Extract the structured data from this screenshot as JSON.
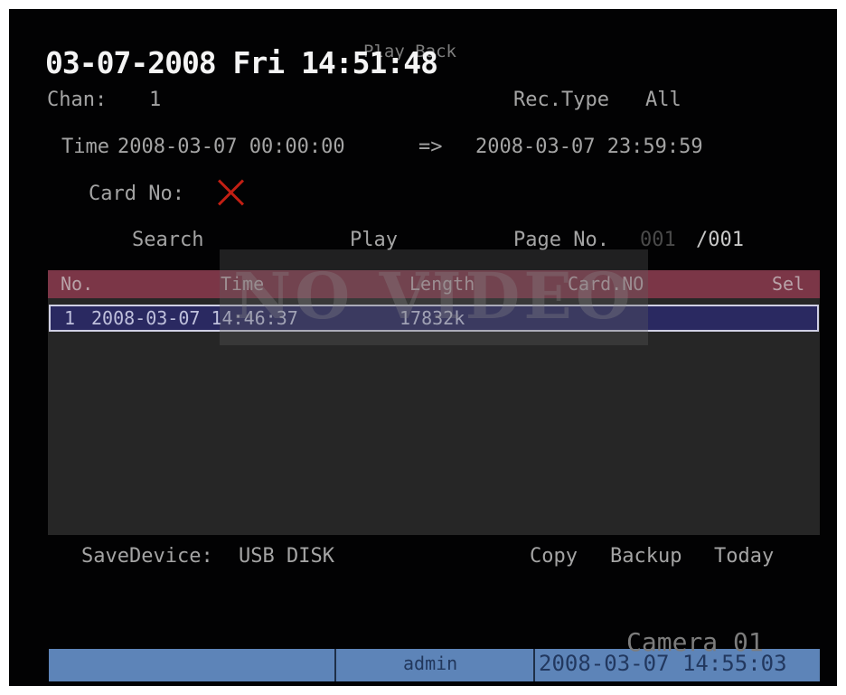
{
  "osd": {
    "clock": "03-07-2008 Fri 14:51:48",
    "screen_title": "Play Back"
  },
  "search": {
    "chan_label": "Chan:",
    "chan_value": "1",
    "rec_type_label": "Rec.Type",
    "rec_type_value": "All",
    "time_label": "Time",
    "time_start": "2008-03-07 00:00:00",
    "time_arrow": "=>",
    "time_end": "2008-03-07 23:59:59",
    "card_no_label": "Card No:",
    "card_no_icon": "red-x-icon"
  },
  "actions": {
    "search_label": "Search",
    "play_label": "Play",
    "page_label": "Page No.",
    "page_current": "001",
    "page_total": "/001"
  },
  "watermark": {
    "text": "NO VIDEO"
  },
  "table": {
    "columns": [
      "No.",
      "Time",
      "Length",
      "Card.NO",
      "Sel"
    ],
    "rows": [
      {
        "no": "1",
        "time": "2008-03-07 14:46:37",
        "length": "17832k",
        "card": "",
        "sel": ""
      }
    ]
  },
  "footer": {
    "save_device_label": "SaveDevice:",
    "save_device_value": "USB DISK",
    "copy_label": "Copy",
    "backup_label": "Backup",
    "today_label": "Today"
  },
  "overlay": {
    "camera_label": "Camera 01"
  },
  "statusbar": {
    "user": "admin",
    "datetime": "2008-03-07 14:55:03"
  },
  "colors": {
    "background": "#020203",
    "header_row": "#7b3647",
    "selected_row": "#2a2961",
    "status_bar": "#5d84b8",
    "card_x": "#c11f14"
  }
}
